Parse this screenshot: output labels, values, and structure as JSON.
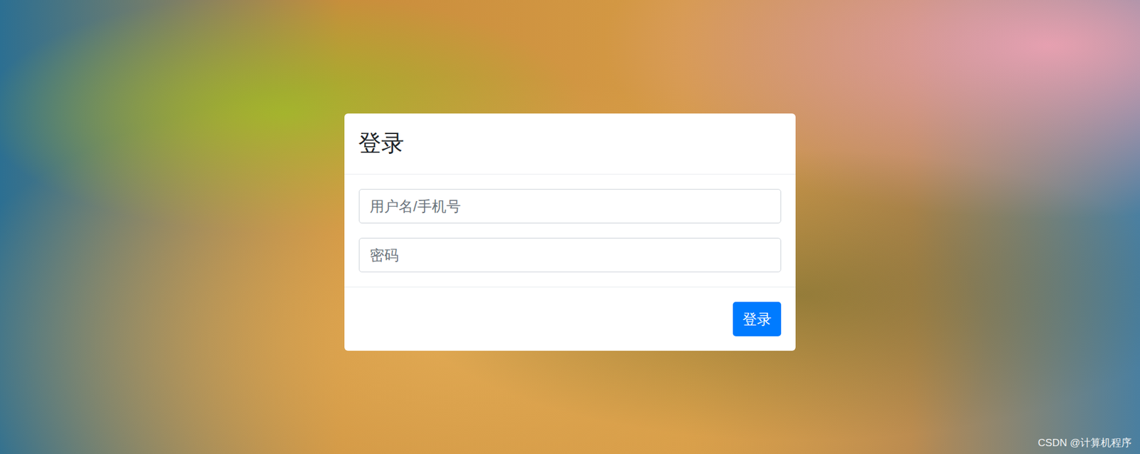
{
  "dialog": {
    "title": "登录",
    "fields": [
      {
        "placeholder": "用户名/手机号",
        "kind": "text"
      },
      {
        "placeholder": "密码",
        "kind": "password"
      }
    ],
    "buttons": [
      "登录"
    ]
  },
  "watermark": "CSDN @计算机程序"
}
